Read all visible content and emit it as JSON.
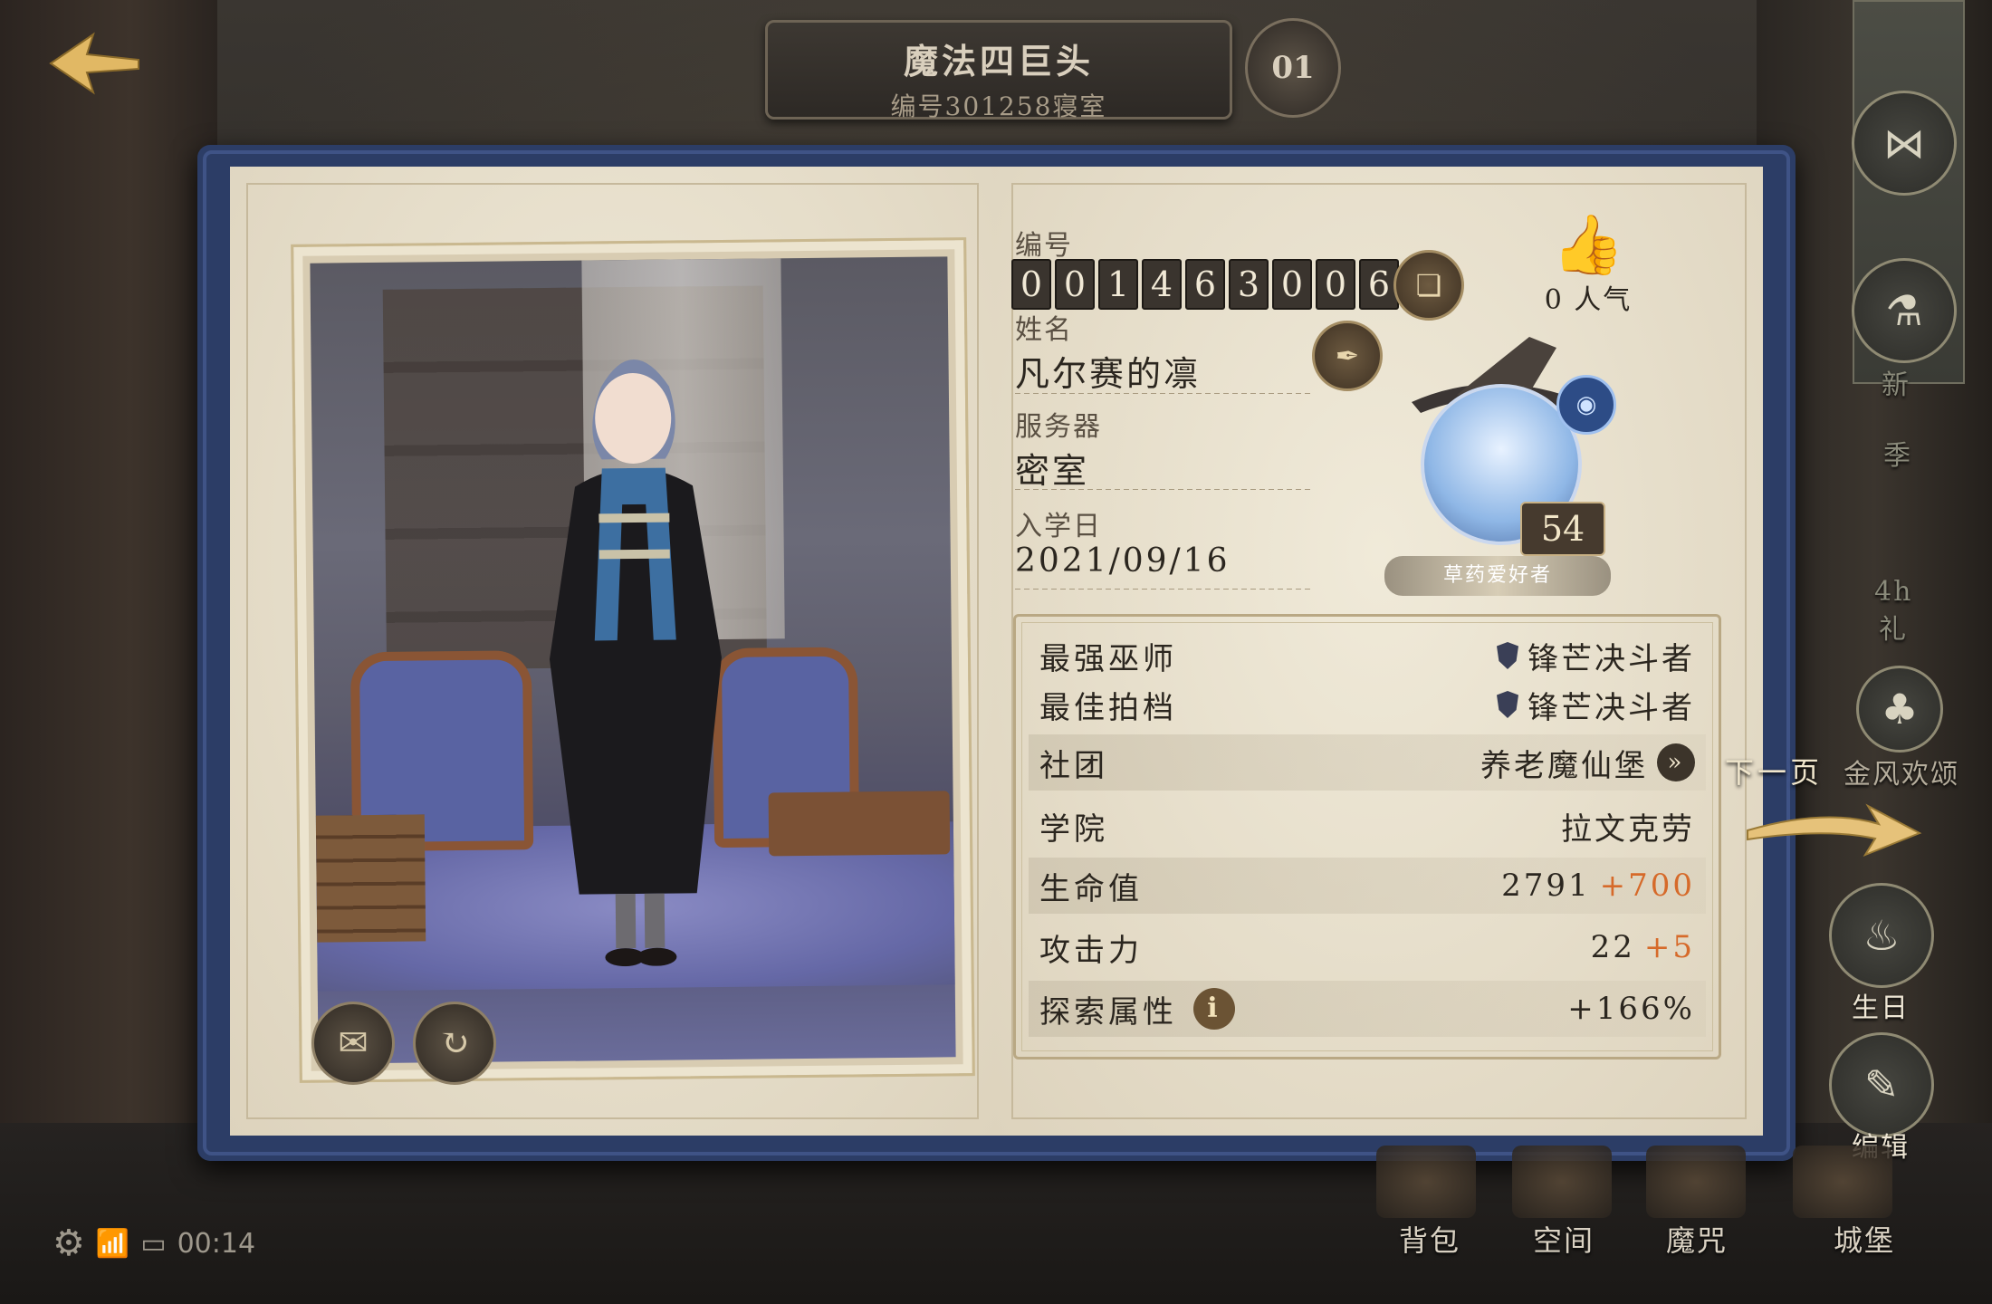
{
  "header": {
    "title": "魔法四巨头",
    "subtitle": "编号301258寝室",
    "calendar_label": "01"
  },
  "profile": {
    "id_label": "编号",
    "id_digits": [
      "0",
      "0",
      "1",
      "4",
      "6",
      "3",
      "0",
      "0",
      "6"
    ],
    "name_label": "姓名",
    "name": "凡尔赛的凛",
    "server_label": "服务器",
    "server": "密室",
    "enroll_label": "入学日",
    "enroll_date": "2021/09/16",
    "popularity": "0 人气",
    "level": "54",
    "title_tag": "草药爱好者"
  },
  "stats": [
    {
      "key": "最强巫师",
      "value": "锋芒决斗者"
    },
    {
      "key": "最佳拍档",
      "value": "锋芒决斗者"
    },
    {
      "key": "社团",
      "value": "养老魔仙堡"
    },
    {
      "key": "学院",
      "value": "拉文克劳"
    },
    {
      "key": "生命值",
      "value": "2791",
      "bonus": "+700"
    },
    {
      "key": "攻击力",
      "value": "22",
      "bonus": "+5"
    },
    {
      "key": "探索属性",
      "value": "+166%"
    }
  ],
  "side": {
    "next_page": "下一页",
    "event_label": "金风欢颂",
    "birthday_label": "生日",
    "edit_label": "编辑",
    "season_label": "季",
    "new_label": "新",
    "gift_time": "4h",
    "gift_label": "礼"
  },
  "bottom_nav": [
    {
      "label": "背包"
    },
    {
      "label": "空间"
    },
    {
      "label": "魔咒"
    },
    {
      "label": "城堡"
    }
  ],
  "status_bar": {
    "time": "00:14"
  },
  "colors": {
    "book_blue": "#2c3d66",
    "page": "#e9e2d2",
    "bonus": "#d66a2a"
  }
}
